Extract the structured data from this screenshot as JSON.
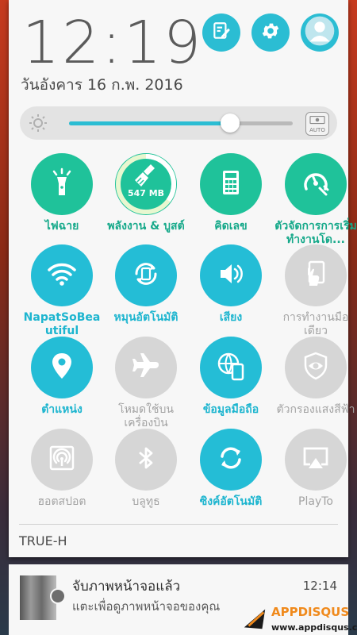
{
  "status": {
    "time": "12:19",
    "date": "วันอังคาร 16 ก.พ. 2016"
  },
  "header_buttons": [
    {
      "icon": "edit-icon"
    },
    {
      "icon": "gear-icon"
    },
    {
      "icon": "user-avatar-icon"
    }
  ],
  "brightness": {
    "level_percent": 72,
    "auto_label": "AUTO"
  },
  "tiles": [
    {
      "label": "ไฟฉาย",
      "icon": "flashlight-icon",
      "state": "on"
    },
    {
      "label": "พลังงาน & บูสต์",
      "icon": "broom-icon",
      "state": "on",
      "badge": "547 MB",
      "ring_percent": 35
    },
    {
      "label": "คิดเลข",
      "icon": "calculator-icon",
      "state": "on"
    },
    {
      "label": "ตัวจัดการการเริ่มทำงานโด...",
      "icon": "autostart-manager-icon",
      "state": "on"
    },
    {
      "label": "NapatSoBeautiful",
      "icon": "wifi-icon",
      "state": "active"
    },
    {
      "label": "หมุนอัตโนมัติ",
      "icon": "auto-rotate-icon",
      "state": "active"
    },
    {
      "label": "เสียง",
      "icon": "volume-icon",
      "state": "active"
    },
    {
      "label": "การทำงานมือเดียว",
      "icon": "one-hand-icon",
      "state": "off"
    },
    {
      "label": "ตำแหน่ง",
      "icon": "location-icon",
      "state": "active"
    },
    {
      "label": "โหมดใช้บนเครื่องบิน",
      "icon": "airplane-icon",
      "state": "off"
    },
    {
      "label": "ข้อมูลมือถือ",
      "icon": "mobile-data-icon",
      "state": "active"
    },
    {
      "label": "ตัวกรองแสงสีฟ้า",
      "icon": "bluelight-filter-icon",
      "state": "off"
    },
    {
      "label": "ฮอตสปอต",
      "icon": "hotspot-icon",
      "state": "off"
    },
    {
      "label": "บลูทูธ",
      "icon": "bluetooth-icon",
      "state": "off"
    },
    {
      "label": "ซิงค์อัตโนมัติ",
      "icon": "sync-icon",
      "state": "active"
    },
    {
      "label": "PlayTo",
      "icon": "playto-icon",
      "state": "off"
    }
  ],
  "carrier": "TRUE-H",
  "notification": {
    "title": "จับภาพหน้าจอแล้ว",
    "text": "แตะเพื่อดูภาพหน้าจอของคุณ",
    "time": "12:14"
  },
  "watermark": {
    "logo": "APPDISQUS",
    "url": "www.appdisqus.com"
  },
  "colors": {
    "accent_green": "#1fc29a",
    "accent_cyan": "#24bdd6",
    "inactive_gray": "#d6d6d6"
  }
}
